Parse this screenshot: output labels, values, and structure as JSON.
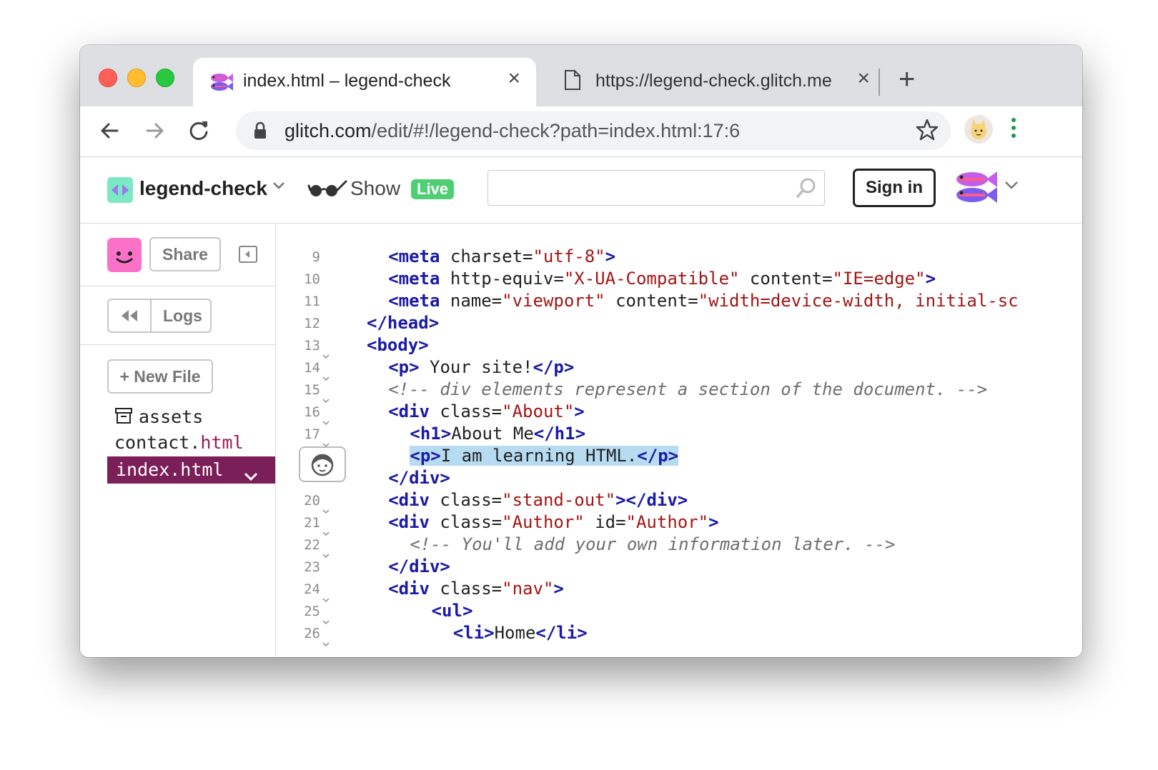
{
  "browser": {
    "tabs": [
      {
        "title": "index.html – legend-check",
        "active": true
      },
      {
        "title": "https://legend-check.glitch.me",
        "active": false
      }
    ],
    "close_glyph": "×",
    "newtab_glyph": "+",
    "url_host": "glitch.com",
    "url_path": "/edit/#!/legend-check?path=index.html:17:6"
  },
  "glitch": {
    "project_name": "legend-check",
    "show_label": "Show",
    "live_badge": "Live",
    "search_value": "",
    "signin_label": "Sign in"
  },
  "sidebar": {
    "share_label": "Share",
    "logs_label": "Logs",
    "newfile_label": "+ New File",
    "files": {
      "assets": "assets",
      "contact_base": "contact.",
      "contact_ext": "html",
      "index": "index.html"
    }
  },
  "editor": {
    "lines": [
      {
        "num": "9",
        "fold": false,
        "indent": 2,
        "tokens": [
          [
            "tag",
            "<meta"
          ],
          [
            "attr",
            " charset="
          ],
          [
            "str",
            "\"utf-8\""
          ],
          [
            "tag",
            ">"
          ]
        ]
      },
      {
        "num": "10",
        "fold": false,
        "indent": 2,
        "tokens": [
          [
            "tag",
            "<meta"
          ],
          [
            "attr",
            " http-equiv="
          ],
          [
            "str",
            "\"X-UA-Compatible\""
          ],
          [
            "attr",
            " content="
          ],
          [
            "str",
            "\"IE=edge\""
          ],
          [
            "tag",
            ">"
          ]
        ]
      },
      {
        "num": "11",
        "fold": false,
        "indent": 2,
        "tokens": [
          [
            "tag",
            "<meta"
          ],
          [
            "attr",
            " name="
          ],
          [
            "str",
            "\"viewport\""
          ],
          [
            "attr",
            " content="
          ],
          [
            "str",
            "\"width=device-width, initial-sc"
          ]
        ]
      },
      {
        "num": "12",
        "fold": false,
        "indent": 1,
        "tokens": [
          [
            "tag",
            "</head>"
          ]
        ]
      },
      {
        "num": "13",
        "fold": true,
        "indent": 1,
        "tokens": [
          [
            "tag",
            "<body>"
          ]
        ]
      },
      {
        "num": "14",
        "fold": true,
        "indent": 2,
        "tokens": [
          [
            "tag",
            "<p>"
          ],
          [
            "txt",
            " Your site!"
          ],
          [
            "tag",
            "</p>"
          ]
        ]
      },
      {
        "num": "15",
        "fold": true,
        "indent": 2,
        "tokens": [
          [
            "cmt",
            "<!-- div elements represent a section of the document. -->"
          ]
        ]
      },
      {
        "num": "16",
        "fold": true,
        "indent": 2,
        "tokens": [
          [
            "tag",
            "<div"
          ],
          [
            "attr",
            " class="
          ],
          [
            "str",
            "\"About\""
          ],
          [
            "tag",
            ">"
          ]
        ]
      },
      {
        "num": "17",
        "fold": true,
        "indent": 3,
        "tokens": [
          [
            "tag",
            "<h1>"
          ],
          [
            "txt",
            "About Me"
          ],
          [
            "tag",
            "</h1>"
          ]
        ]
      },
      {
        "num": "",
        "fold": false,
        "indent": 3,
        "highlight": true,
        "tokens": [
          [
            "tag",
            "<p>"
          ],
          [
            "txt",
            "I am learning HTML."
          ],
          [
            "tag",
            "</p>"
          ]
        ]
      },
      {
        "num": "",
        "fold": false,
        "indent": 2,
        "tokens": [
          [
            "tag",
            "</div>"
          ]
        ]
      },
      {
        "num": "20",
        "fold": true,
        "indent": 2,
        "tokens": [
          [
            "tag",
            "<div"
          ],
          [
            "attr",
            " class="
          ],
          [
            "str",
            "\"stand-out\""
          ],
          [
            "tag",
            "></div>"
          ]
        ]
      },
      {
        "num": "21",
        "fold": true,
        "indent": 2,
        "tokens": [
          [
            "tag",
            "<div"
          ],
          [
            "attr",
            " class="
          ],
          [
            "str",
            "\"Author\""
          ],
          [
            "attr",
            " id="
          ],
          [
            "str",
            "\"Author\""
          ],
          [
            "tag",
            ">"
          ]
        ]
      },
      {
        "num": "22",
        "fold": true,
        "indent": 3,
        "tokens": [
          [
            "cmt",
            "<!-- You'll add your own information later. -->"
          ]
        ]
      },
      {
        "num": "23",
        "fold": false,
        "indent": 2,
        "tokens": [
          [
            "tag",
            "</div>"
          ]
        ]
      },
      {
        "num": "24",
        "fold": true,
        "indent": 2,
        "tokens": [
          [
            "tag",
            "<div"
          ],
          [
            "attr",
            " class="
          ],
          [
            "str",
            "\"nav\""
          ],
          [
            "tag",
            ">"
          ]
        ]
      },
      {
        "num": "25",
        "fold": true,
        "indent": 4,
        "tokens": [
          [
            "tag",
            "<ul>"
          ]
        ]
      },
      {
        "num": "26",
        "fold": true,
        "indent": 5,
        "tokens": [
          [
            "tag",
            "<li>"
          ],
          [
            "txt",
            "Home"
          ],
          [
            "tag",
            "</li>"
          ]
        ]
      }
    ]
  },
  "colors": {
    "tag": "#1a1aa6",
    "string": "#a31515",
    "comment": "#6e6e6e",
    "selection": "#b7dcf2",
    "active_file": "#7b1f58",
    "live_badge": "#4fcf73",
    "avatar": "#fb71c7"
  },
  "icons": [
    "glitch-fish-icon",
    "file-icon",
    "back-arrow-icon",
    "forward-arrow-icon",
    "reload-icon",
    "lock-icon",
    "star-icon",
    "profile-avatar-icon",
    "more-vert-icon",
    "project-logo-icon",
    "chevron-down-icon",
    "glasses-icon",
    "search-icon",
    "collapse-panel-icon",
    "rewind-icon",
    "archive-icon",
    "user-cursor-icon"
  ]
}
